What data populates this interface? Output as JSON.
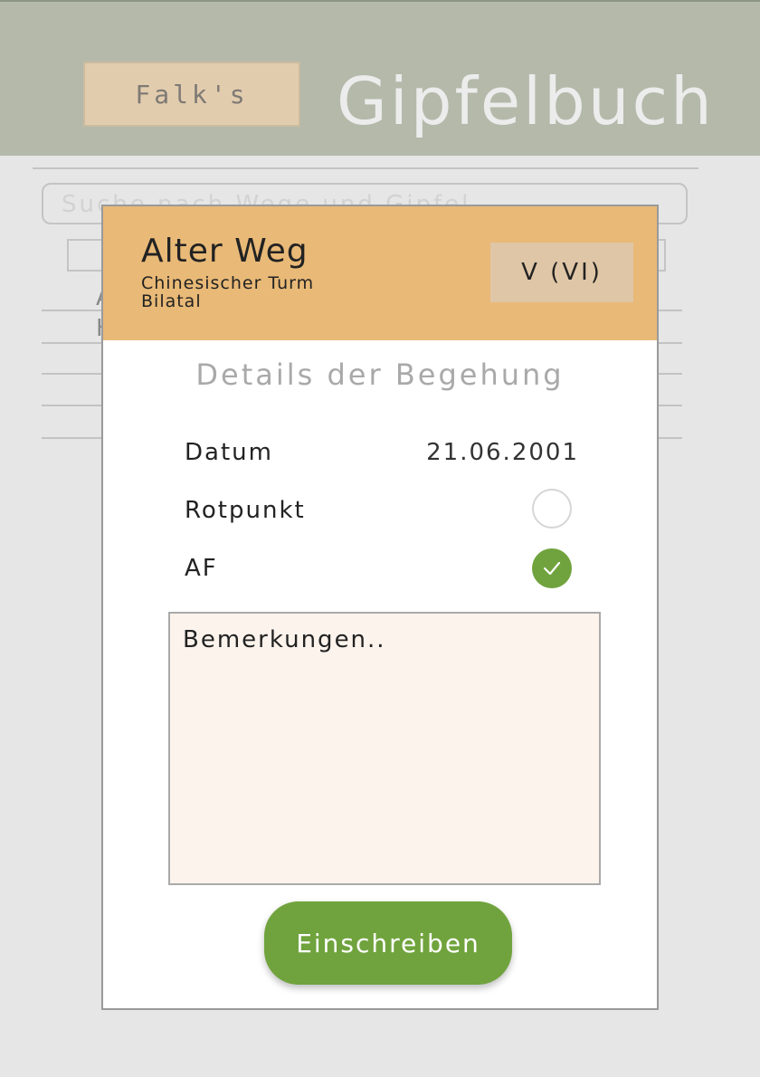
{
  "header": {
    "logo_text": "Falk's",
    "app_title": "Gipfelbuch"
  },
  "background": {
    "search_placeholder": "Suche nach Wege und Gipfel",
    "row_texts": [
      "A",
      "H"
    ]
  },
  "modal": {
    "route_name": "Alter Weg",
    "summit": "Chinesischer Turm",
    "area": "Bilatal",
    "grade": "V (VI)",
    "section_title": "Details der Begehung",
    "fields": {
      "date_label": "Datum",
      "date_value": "21.06.2001",
      "rotpunkt_label": "Rotpunkt",
      "rotpunkt_checked": false,
      "af_label": "AF",
      "af_checked": true
    },
    "notes_placeholder": "Bemerkungen..",
    "submit_label": "Einschreiben"
  },
  "colors": {
    "header_bg": "#b4b9aa",
    "modal_header_bg": "#e9b977",
    "accent_green": "#70a33d",
    "notes_bg": "#fcf3ec"
  },
  "icons": {
    "check_on": "checkmark-icon",
    "check_off": "empty-circle-icon"
  }
}
